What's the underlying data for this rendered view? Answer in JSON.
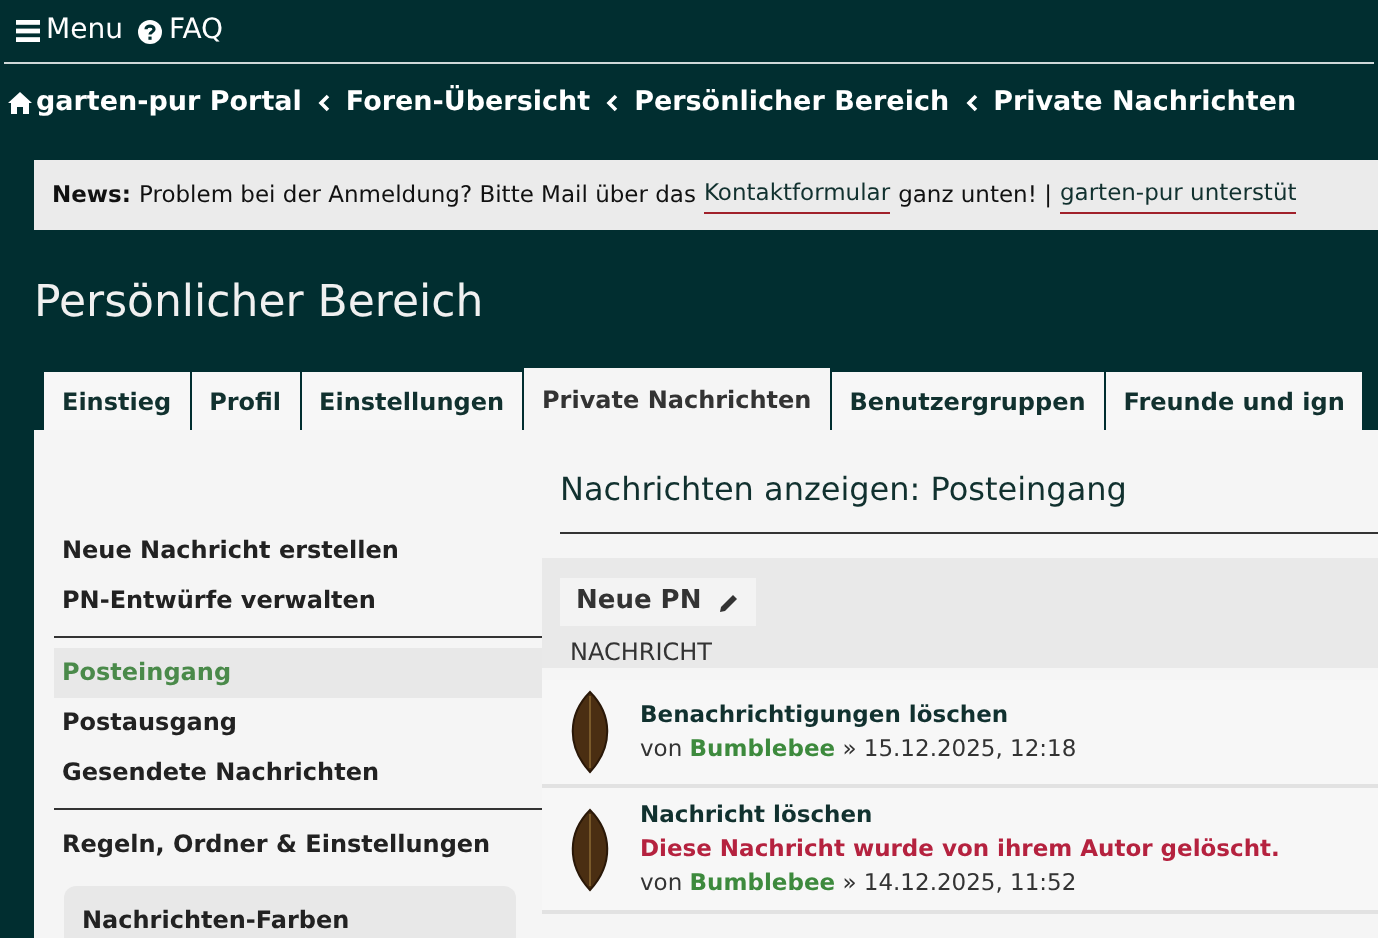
{
  "topbar": {
    "menu": "Menu",
    "faq": "FAQ"
  },
  "breadcrumbs": [
    "garten-pur Portal",
    "Foren-Übersicht",
    "Persönlicher Bereich",
    "Private Nachrichten"
  ],
  "news": {
    "label": "News:",
    "text": "Problem bei der Anmeldung? Bitte Mail über das",
    "link": "Kontaktformular",
    "after": "ganz unten! |",
    "link2": "garten-pur unterstüt"
  },
  "page_title": "Persönlicher Bereich",
  "tabs": [
    {
      "label": "Einstieg",
      "selected": false
    },
    {
      "label": "Profil",
      "selected": false
    },
    {
      "label": "Einstellungen",
      "selected": false
    },
    {
      "label": "Private Nachrichten",
      "selected": true
    },
    {
      "label": "Benutzergruppen",
      "selected": false
    },
    {
      "label": "Freunde und ign",
      "selected": false
    }
  ],
  "sidebar": {
    "groups": [
      [
        {
          "label": "Neue Nachricht erstellen",
          "selected": false
        },
        {
          "label": "PN-Entwürfe verwalten",
          "selected": false
        }
      ],
      [
        {
          "label": "Posteingang",
          "selected": true
        },
        {
          "label": "Postausgang",
          "selected": false
        },
        {
          "label": "Gesendete Nachrichten",
          "selected": false
        }
      ],
      [
        {
          "label": "Regeln, Ordner & Einstellungen",
          "selected": false
        }
      ]
    ],
    "box_title": "Nachrichten-Farben"
  },
  "main": {
    "heading": "Nachrichten anzeigen: Posteingang",
    "new_button": "Neue PN",
    "column": "NACHRICHT",
    "messages": [
      {
        "title": "Benachrichtigungen löschen",
        "by": "von",
        "author": "Bumblebee",
        "date": "» 15.12.2025, 12:18"
      },
      {
        "title": "Nachricht löschen",
        "notice": "Diese Nachricht wurde von ihrem Autor gelöscht.",
        "by": "von",
        "author": "Bumblebee",
        "date": "» 14.12.2025, 11:52"
      }
    ]
  }
}
